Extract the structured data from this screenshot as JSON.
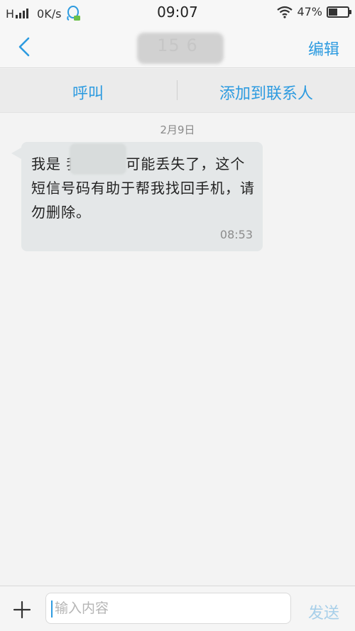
{
  "status_bar": {
    "network": "H",
    "speed": "0K/s",
    "time": "09:07",
    "battery": "47%",
    "battery_level": 0.47,
    "icons": [
      "signal-icon",
      "qq-icon",
      "wifi-icon",
      "battery-icon"
    ]
  },
  "header": {
    "title": "15         6",
    "edit_label": "编辑",
    "back_icon": "chevron-left-icon"
  },
  "actions": {
    "call_label": "呼叫",
    "add_contact_label": "添加到联系人"
  },
  "conversation": {
    "date": "2月9日",
    "messages": [
      {
        "text": "我是        我的手机可能丢失了，这个短信号码有助于帮我找回手机，请勿删除。",
        "time": "08:53"
      }
    ]
  },
  "composer": {
    "placeholder": "输入内容",
    "send_label": "发送",
    "add_icon": "plus-icon"
  },
  "colors": {
    "accent": "#2d9be0",
    "bubble": "#e4e7e8",
    "background": "#f3f3f3"
  }
}
